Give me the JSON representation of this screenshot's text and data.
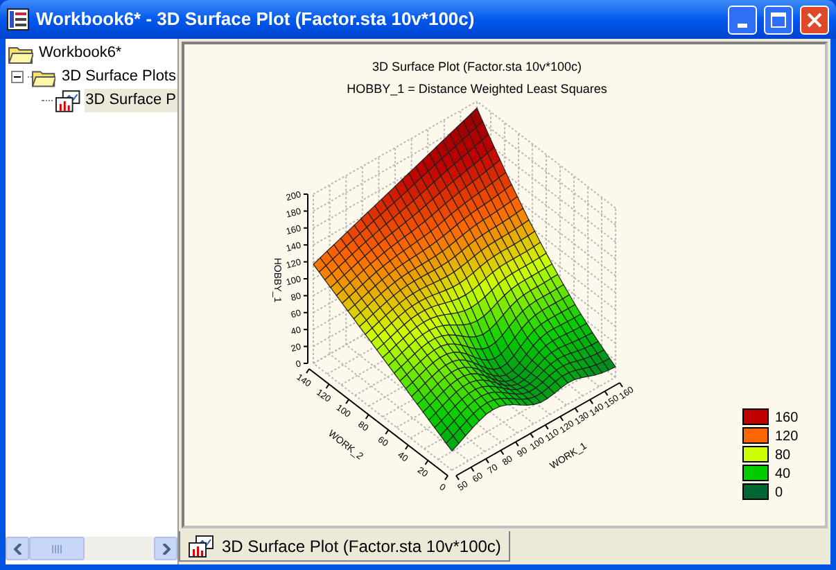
{
  "window": {
    "title": "Workbook6* - 3D Surface Plot (Factor.sta 10v*100c)"
  },
  "tree": [
    {
      "label": "Workbook6*",
      "children": [
        {
          "label": "3D Surface Plots",
          "expanded": true,
          "children": [
            {
              "label": "3D Surface P",
              "selected": true
            }
          ]
        }
      ]
    }
  ],
  "chart": {
    "title": "3D Surface Plot (Factor.sta 10v*100c)",
    "subtitle": "HOBBY_1 = Distance Weighted Least Squares",
    "z_axis": {
      "label": "HOBBY_1",
      "ticks": [
        "0",
        "20",
        "40",
        "60",
        "80",
        "100",
        "120",
        "140",
        "160",
        "180",
        "200"
      ]
    },
    "y_axis": {
      "label": "WORK_2",
      "ticks": [
        "0",
        "20",
        "40",
        "60",
        "80",
        "100",
        "120",
        "140"
      ]
    },
    "x_axis": {
      "label": "WORK_1",
      "ticks": [
        "50",
        "60",
        "70",
        "80",
        "90",
        "100",
        "110",
        "120",
        "130",
        "140",
        "150",
        "160"
      ]
    },
    "legend": [
      {
        "label": "160",
        "color": "#c00000"
      },
      {
        "label": "120",
        "color": "#ff6600"
      },
      {
        "label": "80",
        "color": "#ccff00"
      },
      {
        "label": "40",
        "color": "#00cc00"
      },
      {
        "label": "0",
        "color": "#006633"
      }
    ]
  },
  "tabs": [
    {
      "label": "3D Surface Plot (Factor.sta 10v*100c)",
      "selected": true
    }
  ]
}
